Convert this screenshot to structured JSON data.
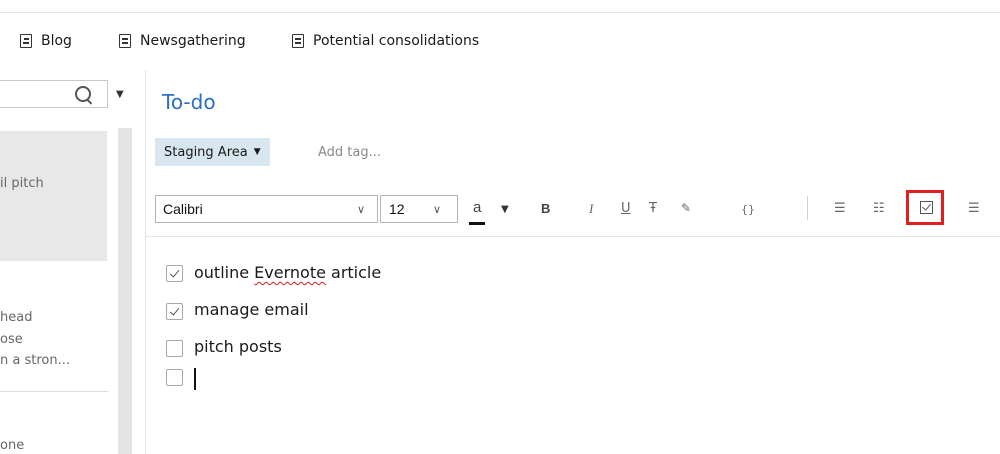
{
  "shortcuts": [
    {
      "label": "Blog",
      "icon": "notebook-icon"
    },
    {
      "label": "Newsgathering",
      "icon": "note-icon"
    },
    {
      "label": "Potential consolidations",
      "icon": "note-icon"
    }
  ],
  "note_list": {
    "search_icon": "search-icon",
    "snippets": {
      "card1": "il pitch",
      "card2_line1": "head",
      "card2_line2": "ose",
      "card2_line3": "n a stron...",
      "card3": "one"
    }
  },
  "note": {
    "title": "To-do",
    "tag": "Staging Area",
    "add_tag_placeholder": "Add tag...",
    "checklist": [
      {
        "before": "outline ",
        "misspelled": "Evernote",
        "after": " article",
        "checked": true
      },
      {
        "text": "manage email",
        "checked": true
      },
      {
        "text": "pitch posts",
        "checked": false
      },
      {
        "text": "",
        "checked": false
      }
    ]
  },
  "toolbar": {
    "font": "Calibri",
    "size": "12",
    "color_letter": "a",
    "bold": "B",
    "italic": "I",
    "underline": "U",
    "strike": "Ŧ",
    "highlight": "✎",
    "code": "{}",
    "bullets": "☰",
    "numbers": "☷",
    "align": "☰",
    "highlight_color": "#e02020",
    "tag_chip_color": "#d8e6ef",
    "title_color": "#2a6fc0"
  }
}
